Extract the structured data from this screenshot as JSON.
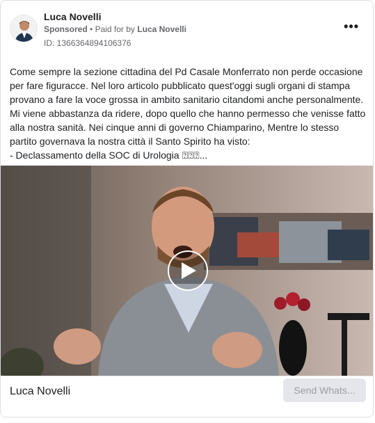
{
  "post": {
    "author": "Luca Novelli",
    "sponsored_label": "Sponsored",
    "separator": "•",
    "paid_prefix": "Paid for by",
    "paid_by": "Luca Novelli",
    "id_label": "ID: 1366364894106376",
    "more_label": "•••",
    "text_lines": [
      "Come sempre la sezione cittadina del Pd Casale Monferrato non perde occasione",
      "per fare figuracce. Nel loro articolo pubblicato quest'oggi sugli organi di stampa",
      "provano a fare la voce grossa in ambito sanitario citandomi anche personalmente.",
      "Mi viene abbastanza da ridere, dopo quello che hanno permesso che venisse fatto",
      "alla nostra sanità. Nei cinque anni di governo Chiamparino, Mentre lo stesso",
      "partito governava la nostra città il Santo Spirito ha visto:",
      "- Declassamento della SOC di Urologia ⍰⍰⍰..."
    ]
  },
  "footer": {
    "title": "Luca Novelli",
    "cta_label": "Send Whats..."
  },
  "icons": {
    "avatar": "avatar-photo",
    "more": "more-options-icon",
    "play": "play-icon"
  }
}
